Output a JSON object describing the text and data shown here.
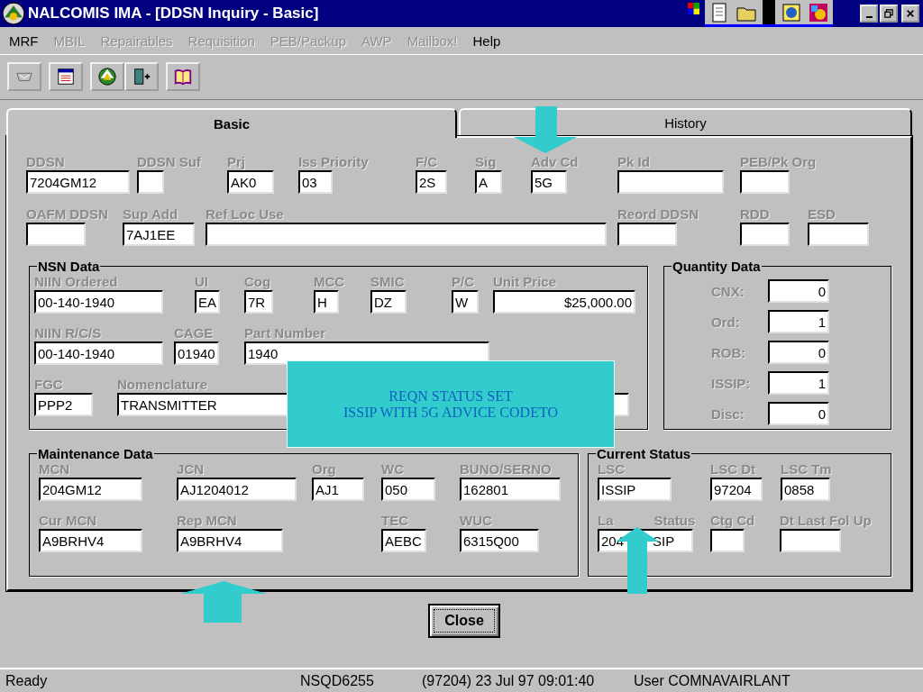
{
  "window": {
    "title": "NALCOMIS IMA - [DDSN Inquiry - Basic]"
  },
  "menu": [
    {
      "label": "MRF",
      "disabled": false
    },
    {
      "label": "MBIL",
      "disabled": true
    },
    {
      "label": "Repairables",
      "disabled": true
    },
    {
      "label": "Requisition",
      "disabled": true
    },
    {
      "label": "PEB/Packup",
      "disabled": true
    },
    {
      "label": "AWP",
      "disabled": true
    },
    {
      "label": "Mailbox!",
      "disabled": true
    },
    {
      "label": "Help",
      "disabled": false
    }
  ],
  "tabs": [
    {
      "label": "Basic",
      "selected": true
    },
    {
      "label": "History",
      "selected": false
    }
  ],
  "header_rows": [
    [
      {
        "label": "DDSN",
        "value": "7204GM12"
      },
      {
        "label": "DDSN Suf"
      },
      {
        "label": "Prj",
        "value": "AK0"
      },
      {
        "label": "Iss Priority",
        "value": "03"
      },
      {
        "label": "F/C",
        "value": "2S"
      },
      {
        "label": "Sig",
        "value": "A"
      },
      {
        "label": "Adv Cd",
        "value": "5G"
      },
      {
        "label": "Pk Id"
      },
      {
        "label": "PEB/Pk Org"
      }
    ],
    [
      {
        "label": "OAFM DDSN"
      },
      {
        "label": "Sup Add",
        "value": "7AJ1EE"
      },
      {
        "label": "Ref Loc Use"
      },
      {
        "label": "Reord DDSN"
      },
      {
        "label": "RDD"
      },
      {
        "label": "ESD"
      }
    ]
  ],
  "nsn_data": {
    "title": "NSN Data",
    "rows": [
      [
        {
          "label": "NIIN Ordered",
          "value": "00-140-1940"
        },
        {
          "label": "UI",
          "value": "EA"
        },
        {
          "label": "Cog",
          "value": "7R"
        },
        {
          "label": "MCC",
          "value": "H"
        },
        {
          "label": "SMIC",
          "value": "DZ"
        },
        {
          "label": "P/C",
          "value": "W"
        },
        {
          "label": "Unit Price",
          "value": "$25,000.00"
        }
      ],
      [
        {
          "label": "NIIN R/C/S",
          "value": "00-140-1940"
        },
        {
          "label": "CAGE",
          "value": "01940"
        },
        {
          "label": "Part Number",
          "value": "1940"
        }
      ],
      [
        {
          "label": "FGC",
          "value": "PPP2"
        },
        {
          "label": "Nomenclature",
          "value": "TRANSMITTER"
        }
      ]
    ]
  },
  "quantity_data": {
    "title": "Quantity Data",
    "rows": [
      {
        "label": "CNX:",
        "value": "0"
      },
      {
        "label": "Ord:",
        "value": "1"
      },
      {
        "label": "ROB:",
        "value": "0"
      },
      {
        "label": "ISSIP:",
        "value": "1"
      },
      {
        "label": "Disc:",
        "value": "0"
      }
    ]
  },
  "maintenance_data": {
    "title": "Maintenance Data",
    "rows": [
      [
        {
          "label": "MCN",
          "value": "204GM12"
        },
        {
          "label": "JCN",
          "value": "AJ1204012"
        },
        {
          "label": "Org",
          "value": "AJ1"
        },
        {
          "label": "WC",
          "value": "050"
        },
        {
          "label": "BUNO/SERNO",
          "value": "162801"
        }
      ],
      [
        {
          "label": "Cur MCN",
          "value": "A9BRHV4"
        },
        {
          "label": "Rep MCN",
          "value": "A9BRHV4"
        },
        {},
        {
          "label": "TEC",
          "value": "AEBC"
        },
        {
          "label": "WUC",
          "value": "6315Q00"
        }
      ]
    ]
  },
  "current_status": {
    "title": "Current Status",
    "rows": [
      [
        {
          "label": "LSC",
          "value": "ISSIP"
        },
        {
          "label": "LSC Dt",
          "value": "97204"
        },
        {
          "label": "LSC Tm",
          "value": "0858"
        }
      ],
      [
        {
          "label": [
            "La",
            "Status"
          ],
          "value": [
            "204",
            "SIP"
          ]
        },
        {
          "label": "Ctg Cd"
        },
        {
          "label": "Dt Last Fol Up"
        }
      ]
    ]
  },
  "close_button": "Close",
  "status_bar": [
    "Ready",
    "NSQD6255",
    "(97204)  23 Jul 97  09:01:40",
    "User COMNAVAIRLANT"
  ],
  "callout": {
    "lines": [
      "REQN STATUS SET",
      "ISSIP  WITH 5G ADVICE CODETO"
    ]
  }
}
